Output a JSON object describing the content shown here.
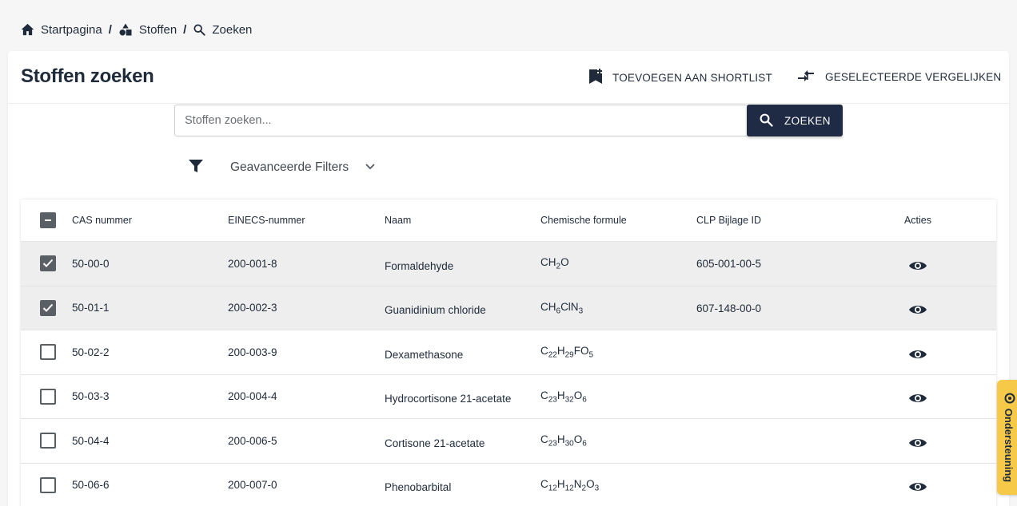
{
  "breadcrumb": {
    "home": "Startpagina",
    "substances": "Stoffen",
    "search": "Zoeken",
    "separator": "/"
  },
  "header": {
    "title": "Stoffen zoeken",
    "shortlist_label": "TOEVOEGEN AAN SHORTLIST",
    "compare_label": "GESELECTEERDE VERGELIJKEN"
  },
  "search": {
    "placeholder": "Stoffen zoeken...",
    "value": "",
    "button_label": "ZOEKEN"
  },
  "filters": {
    "label": "Geavanceerde Filters"
  },
  "table": {
    "columns": {
      "cas": "CAS nummer",
      "einecs": "EINECS-nummer",
      "naam": "Naam",
      "formula": "Chemische formule",
      "clp": "CLP Bijlage ID",
      "acties": "Acties"
    },
    "rows": [
      {
        "checked": true,
        "cas": "50-00-0",
        "einecs": "200-001-8",
        "naam": "Formaldehyde",
        "formula": [
          [
            "CH",
            ""
          ],
          [
            "2",
            "sub"
          ],
          [
            "O",
            ""
          ]
        ],
        "clp": "605-001-00-5"
      },
      {
        "checked": true,
        "cas": "50-01-1",
        "einecs": "200-002-3",
        "naam": "Guanidinium chloride",
        "formula": [
          [
            "CH",
            ""
          ],
          [
            "6",
            "sub"
          ],
          [
            "ClN",
            ""
          ],
          [
            "3",
            "sub"
          ]
        ],
        "clp": "607-148-00-0"
      },
      {
        "checked": false,
        "cas": "50-02-2",
        "einecs": "200-003-9",
        "naam": "Dexamethasone",
        "formula": [
          [
            "C",
            ""
          ],
          [
            "22",
            "sub"
          ],
          [
            "H",
            ""
          ],
          [
            "29",
            "sub"
          ],
          [
            "FO",
            ""
          ],
          [
            "5",
            "sub"
          ]
        ],
        "clp": ""
      },
      {
        "checked": false,
        "cas": "50-03-3",
        "einecs": "200-004-4",
        "naam": "Hydrocortisone 21-acetate",
        "formula": [
          [
            "C",
            ""
          ],
          [
            "23",
            "sub"
          ],
          [
            "H",
            ""
          ],
          [
            "32",
            "sub"
          ],
          [
            "O",
            ""
          ],
          [
            "6",
            "sub"
          ]
        ],
        "clp": ""
      },
      {
        "checked": false,
        "cas": "50-04-4",
        "einecs": "200-006-5",
        "naam": "Cortisone 21-acetate",
        "formula": [
          [
            "C",
            ""
          ],
          [
            "23",
            "sub"
          ],
          [
            "H",
            ""
          ],
          [
            "30",
            "sub"
          ],
          [
            "O",
            ""
          ],
          [
            "6",
            "sub"
          ]
        ],
        "clp": ""
      },
      {
        "checked": false,
        "cas": "50-06-6",
        "einecs": "200-007-0",
        "naam": "Phenobarbital",
        "formula": [
          [
            "C",
            ""
          ],
          [
            "12",
            "sub"
          ],
          [
            "H",
            ""
          ],
          [
            "12",
            "sub"
          ],
          [
            "N",
            ""
          ],
          [
            "2",
            "sub"
          ],
          [
            "O",
            ""
          ],
          [
            "3",
            "sub"
          ]
        ],
        "clp": ""
      }
    ]
  },
  "support": {
    "label": "Ondersteuning"
  },
  "colors": {
    "primary": "#1f2a44",
    "accent": "#f7c948",
    "selected_row": "#eeeeee",
    "checkbox": "#5a5f66"
  },
  "icons": {
    "home": "home-icon",
    "substances": "shapes-icon",
    "search": "search-icon",
    "shortlist": "bookmark-add-icon",
    "compare": "compare-arrows-icon",
    "filter": "filter-icon",
    "chevron": "chevron-down-icon",
    "view": "eye-icon",
    "support": "support-icon"
  }
}
